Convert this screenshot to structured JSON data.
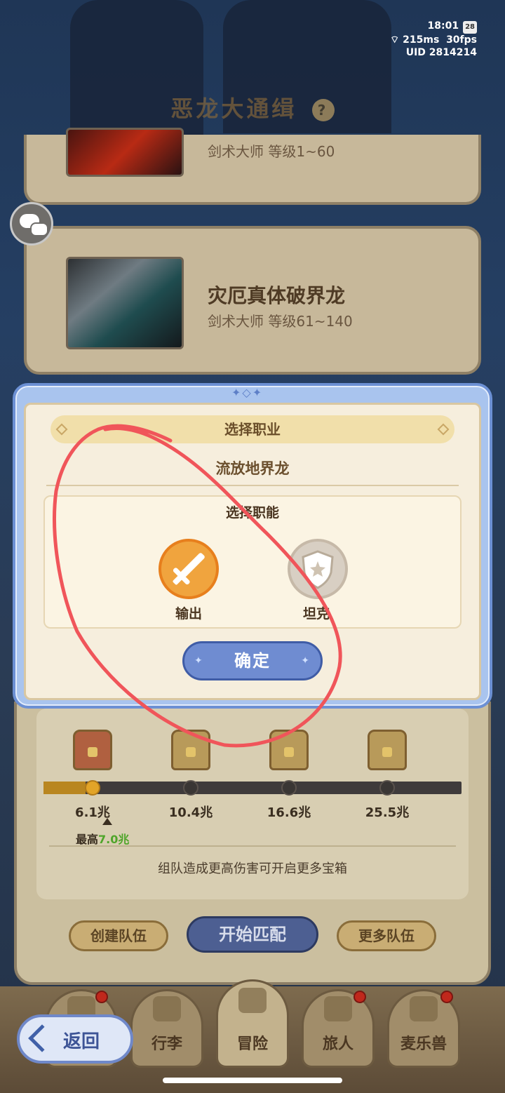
{
  "status_bar": {
    "time": "18:01",
    "battery": "28",
    "ping": "215ms",
    "fps": "30fps",
    "uid": "UID 2814214"
  },
  "page_title": "恶龙大通缉",
  "page_title_icon": "help-icon",
  "bosses": [
    {
      "name": "",
      "level": "剑术大师  等级1~60"
    },
    {
      "name": "灾厄真体破界龙",
      "level": "剑术大师  等级61~140"
    }
  ],
  "modal": {
    "title": "选择职业",
    "boss_name": "流放地界龙",
    "section_heading": "选择职能",
    "roles": [
      {
        "label": "输出",
        "icon": "sword-icon",
        "selected": true
      },
      {
        "label": "坦克",
        "icon": "shield-icon",
        "selected": false
      }
    ],
    "confirm_label": "确定"
  },
  "rewards": {
    "milestones": [
      "6.1兆",
      "10.4兆",
      "16.6兆",
      "25.5兆"
    ],
    "best_prefix": "最高",
    "best_value": "7.0兆",
    "progress_fraction": 0.1,
    "hint": "组队造成更高伤害可开启更多宝箱"
  },
  "team_actions": {
    "create": "创建队伍",
    "match": "开始匹配",
    "more": "更多队伍"
  },
  "nav": {
    "items": [
      {
        "label": "",
        "icon": "castle-icon",
        "badge": true
      },
      {
        "label": "行李",
        "icon": "backpack-icon",
        "badge": false
      },
      {
        "label": "冒险",
        "icon": "crossed-swords-icon",
        "badge": false
      },
      {
        "label": "旅人",
        "icon": "character-icon",
        "badge": true
      },
      {
        "label": "麦乐兽",
        "icon": "pet-icon",
        "badge": true
      }
    ]
  },
  "back_label": "返回",
  "colors": {
    "selected_role": "#f0a43e",
    "confirm": "#6f8cd1",
    "annotation": "#f0555a",
    "best_value": "#4fa52a"
  }
}
